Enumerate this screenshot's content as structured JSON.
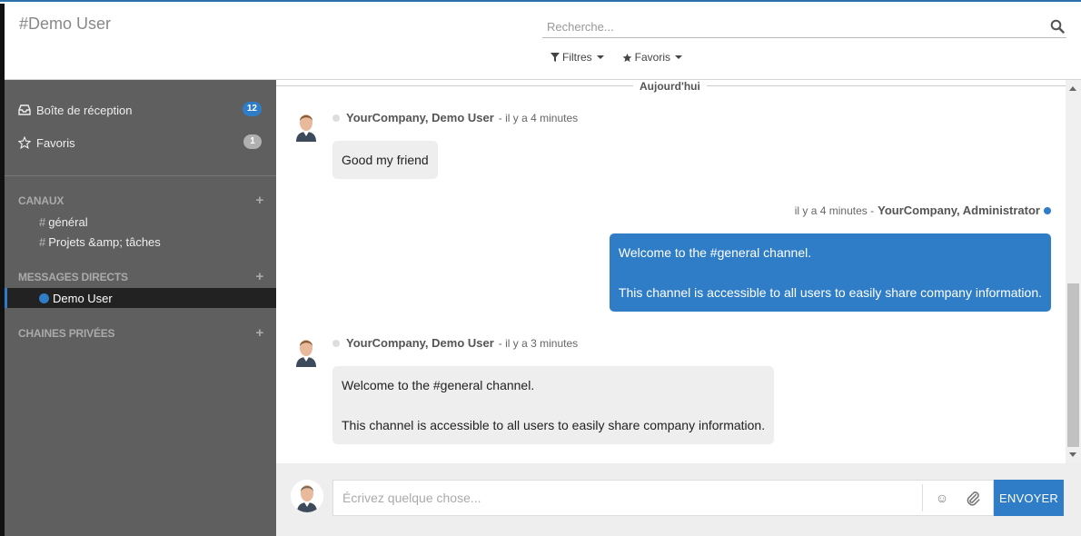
{
  "control_panel": {
    "title": "#Demo User",
    "search_placeholder": "Recherche...",
    "filters_label": "Filtres",
    "favorites_label": "Favoris"
  },
  "sidebar": {
    "inbox_label": "Boîte de réception",
    "inbox_count": "12",
    "starred_label": "Favoris",
    "starred_count": "1",
    "channels_header": "CANAUX",
    "channels": [
      {
        "label": "général"
      },
      {
        "label": "Projets &amp; tâches"
      }
    ],
    "dm_header": "MESSAGES DIRECTS",
    "dm_active": "Demo User",
    "private_header": "CHAINES PRIVÉES",
    "plus": "+"
  },
  "thread": {
    "day_label": "Aujourd'hui",
    "messages": [
      {
        "author": "YourCompany, Demo User",
        "time": "- il y a 4 minutes",
        "body": [
          "Good my friend"
        ]
      },
      {
        "author": "YourCompany, Administrator",
        "time": "il y a 4 minutes -",
        "body": [
          "Welcome to the #general channel.",
          "This channel is accessible to all users to easily share company information."
        ]
      },
      {
        "author": "YourCompany, Demo User",
        "time": "- il y a 3 minutes",
        "body": [
          "Welcome to the #general channel.",
          "This channel is accessible to all users to easily share company information."
        ]
      }
    ]
  },
  "composer": {
    "placeholder": "Écrivez quelque chose...",
    "emoji_icon": "☺",
    "send_label": "ENVOYER"
  },
  "colors": {
    "accent": "#2f7dc6",
    "sidebar_bg": "#5f5f5f",
    "active_bg": "#222222"
  }
}
